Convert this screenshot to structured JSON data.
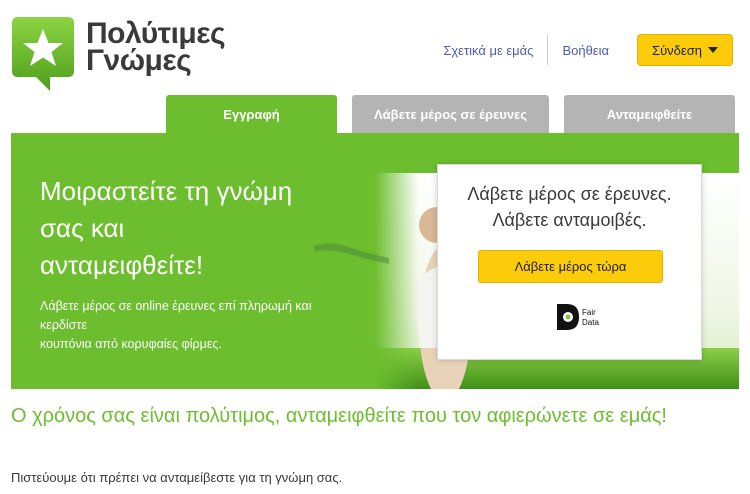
{
  "brand": {
    "name_line1": "Πολύτιμες",
    "name_line2": "Γνώμες",
    "green": "#6cbe2e",
    "yellow": "#fccb0a",
    "gray": "#b4b4b4",
    "logo_icon": "star-icon"
  },
  "nav": {
    "about": "Σχετικά με εμάς",
    "help": "Βοήθεια",
    "login": "Σύνδεση",
    "login_icon": "caret-down-icon"
  },
  "tabs": [
    {
      "label": "Εγγραφή",
      "active": true
    },
    {
      "label": "Λάβετε μέρος σε έρευνες",
      "active": false
    },
    {
      "label": "Ανταμειφθείτε",
      "active": false
    }
  ],
  "hero": {
    "title_line1": "Μοιραστείτε τη γνώμη",
    "title_line2": "σας και",
    "title_line3": "ανταμειφθείτε!",
    "sub_line1": "Λάβετε μέρος σε online έρευνες επί πληρωμή και",
    "sub_line2": "κερδίστε",
    "sub_line3": "κουπόνια από κορυφαίες φίρμες."
  },
  "cta": {
    "line1": "Λάβετε μέρος σε έρευνες.",
    "line2": "Λάβετε ανταμοιβές.",
    "button": "Λάβετε μέρος τώρα",
    "fairdata_line1": "Fair",
    "fairdata_line2": "Data"
  },
  "bottom": {
    "heading": "Ο χρόνος σας είναι πολύτιμος, ανταμειφθείτε που τον αφιερώνετε σε εμάς!",
    "text": "Πιστεύουμε ότι πρέπει να ανταμείβεστε για τη γνώμη σας."
  }
}
